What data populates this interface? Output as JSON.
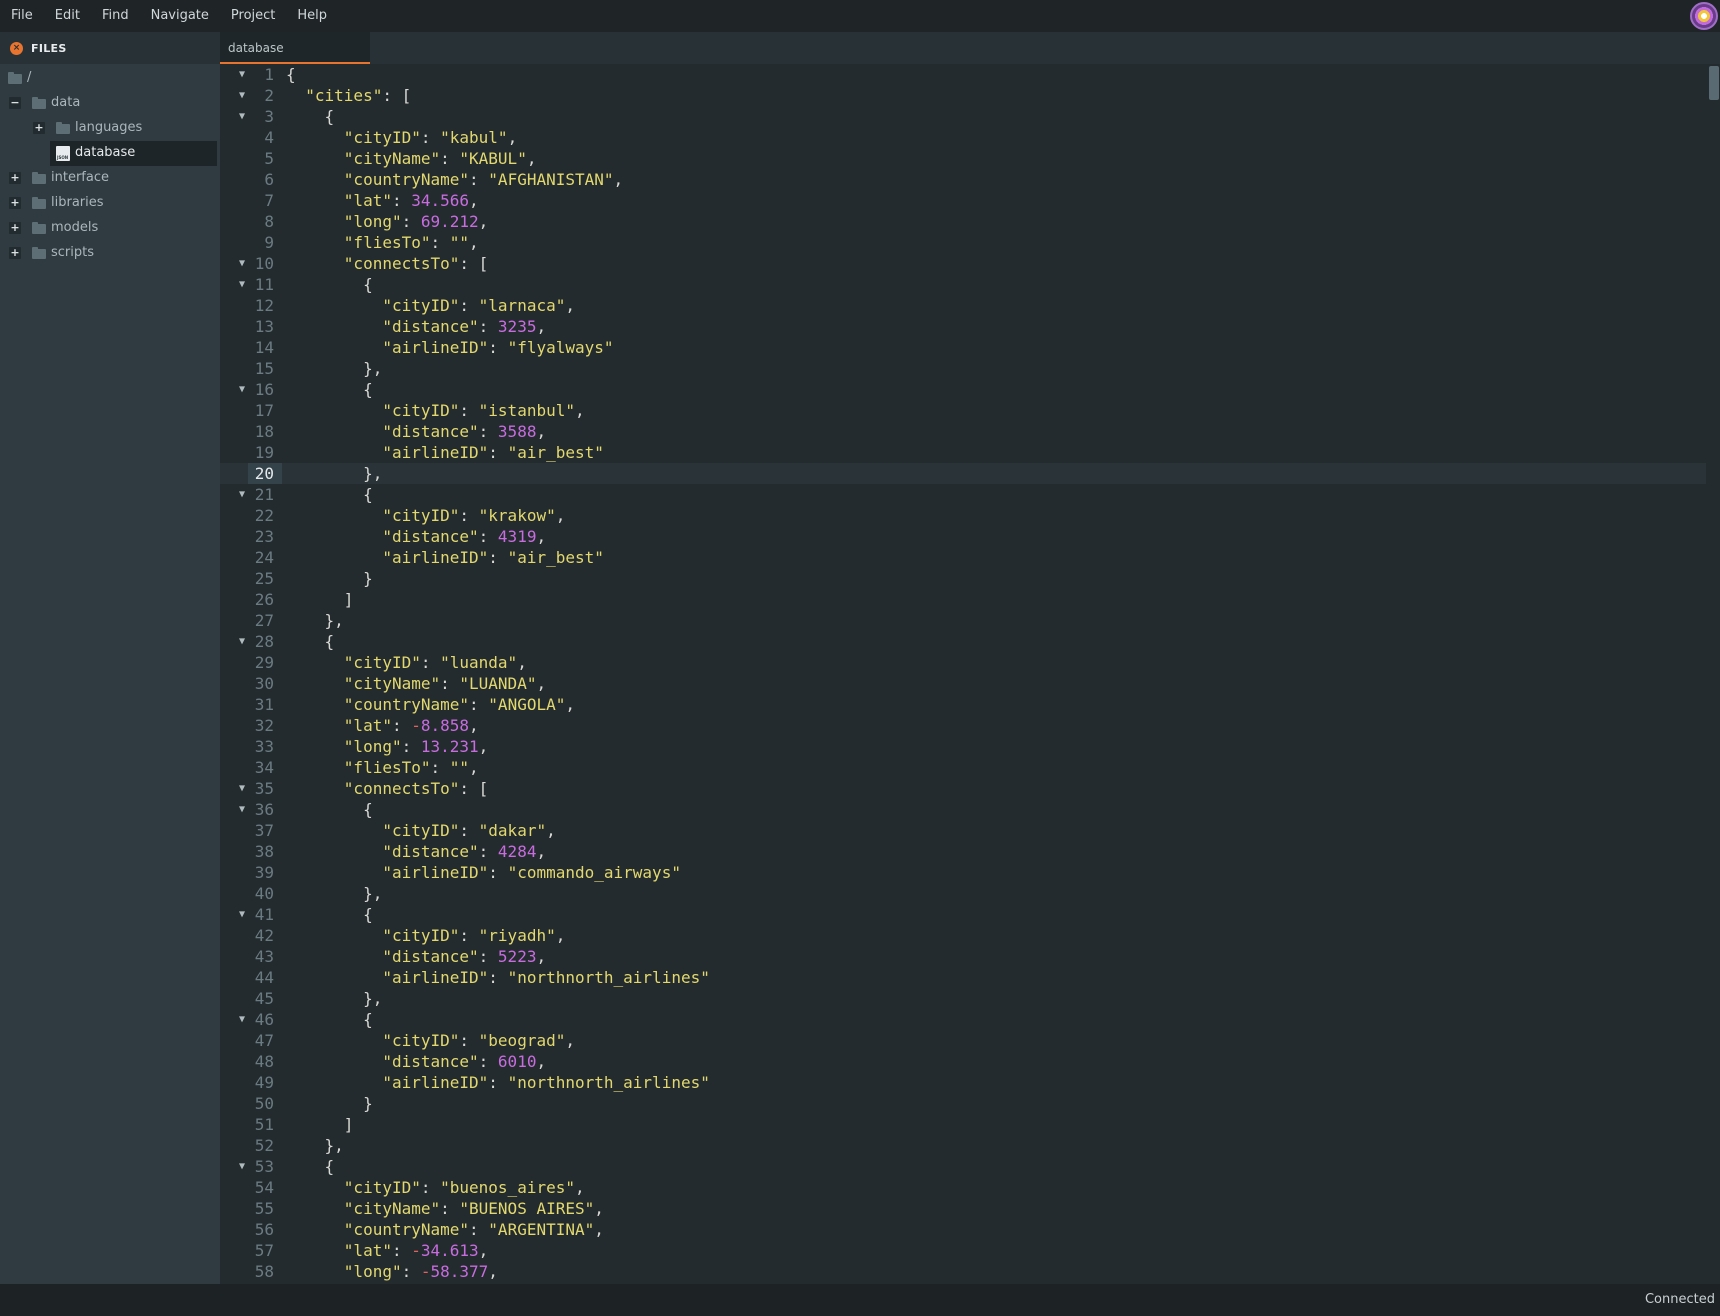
{
  "menubar": {
    "items": [
      "File",
      "Edit",
      "Find",
      "Navigate",
      "Project",
      "Help"
    ]
  },
  "sidebar": {
    "title": "FILES",
    "tree": [
      {
        "label": "/",
        "toggle": "",
        "type": "folder",
        "depth": 0
      },
      {
        "label": "data",
        "toggle": "−",
        "type": "folder",
        "depth": 1
      },
      {
        "label": "languages",
        "toggle": "+",
        "type": "folder",
        "depth": 2
      },
      {
        "label": "database",
        "toggle": "",
        "type": "file",
        "depth": 2,
        "selected": true
      },
      {
        "label": "interface",
        "toggle": "+",
        "type": "folder",
        "depth": 1
      },
      {
        "label": "libraries",
        "toggle": "+",
        "type": "folder",
        "depth": 1
      },
      {
        "label": "models",
        "toggle": "+",
        "type": "folder",
        "depth": 1
      },
      {
        "label": "scripts",
        "toggle": "+",
        "type": "folder",
        "depth": 1
      }
    ]
  },
  "tabs": [
    {
      "label": "database",
      "active": true
    }
  ],
  "editor": {
    "active_line": 20,
    "lines": [
      {
        "n": 1,
        "fold": true,
        "code": [
          [
            "p",
            "{"
          ]
        ]
      },
      {
        "n": 2,
        "fold": true,
        "code": [
          [
            "p",
            "  "
          ],
          [
            "k",
            "\"cities\""
          ],
          [
            "p",
            ": ["
          ]
        ]
      },
      {
        "n": 3,
        "fold": true,
        "code": [
          [
            "p",
            "    {"
          ]
        ]
      },
      {
        "n": 4,
        "fold": false,
        "code": [
          [
            "p",
            "      "
          ],
          [
            "k",
            "\"cityID\""
          ],
          [
            "p",
            ": "
          ],
          [
            "s",
            "\"kabul\""
          ],
          [
            "p",
            ","
          ]
        ]
      },
      {
        "n": 5,
        "fold": false,
        "code": [
          [
            "p",
            "      "
          ],
          [
            "k",
            "\"cityName\""
          ],
          [
            "p",
            ": "
          ],
          [
            "s",
            "\"KABUL\""
          ],
          [
            "p",
            ","
          ]
        ]
      },
      {
        "n": 6,
        "fold": false,
        "code": [
          [
            "p",
            "      "
          ],
          [
            "k",
            "\"countryName\""
          ],
          [
            "p",
            ": "
          ],
          [
            "s",
            "\"AFGHANISTAN\""
          ],
          [
            "p",
            ","
          ]
        ]
      },
      {
        "n": 7,
        "fold": false,
        "code": [
          [
            "p",
            "      "
          ],
          [
            "k",
            "\"lat\""
          ],
          [
            "p",
            ": "
          ],
          [
            "n",
            "34.566"
          ],
          [
            "p",
            ","
          ]
        ]
      },
      {
        "n": 8,
        "fold": false,
        "code": [
          [
            "p",
            "      "
          ],
          [
            "k",
            "\"long\""
          ],
          [
            "p",
            ": "
          ],
          [
            "n",
            "69.212"
          ],
          [
            "p",
            ","
          ]
        ]
      },
      {
        "n": 9,
        "fold": false,
        "code": [
          [
            "p",
            "      "
          ],
          [
            "k",
            "\"fliesTo\""
          ],
          [
            "p",
            ": "
          ],
          [
            "s",
            "\"\""
          ],
          [
            "p",
            ","
          ]
        ]
      },
      {
        "n": 10,
        "fold": true,
        "code": [
          [
            "p",
            "      "
          ],
          [
            "k",
            "\"connectsTo\""
          ],
          [
            "p",
            ": ["
          ]
        ]
      },
      {
        "n": 11,
        "fold": true,
        "code": [
          [
            "p",
            "        {"
          ]
        ]
      },
      {
        "n": 12,
        "fold": false,
        "code": [
          [
            "p",
            "          "
          ],
          [
            "k",
            "\"cityID\""
          ],
          [
            "p",
            ": "
          ],
          [
            "s",
            "\"larnaca\""
          ],
          [
            "p",
            ","
          ]
        ]
      },
      {
        "n": 13,
        "fold": false,
        "code": [
          [
            "p",
            "          "
          ],
          [
            "k",
            "\"distance\""
          ],
          [
            "p",
            ": "
          ],
          [
            "n",
            "3235"
          ],
          [
            "p",
            ","
          ]
        ]
      },
      {
        "n": 14,
        "fold": false,
        "code": [
          [
            "p",
            "          "
          ],
          [
            "k",
            "\"airlineID\""
          ],
          [
            "p",
            ": "
          ],
          [
            "s",
            "\"flyalways\""
          ]
        ]
      },
      {
        "n": 15,
        "fold": false,
        "code": [
          [
            "p",
            "        },"
          ]
        ]
      },
      {
        "n": 16,
        "fold": true,
        "code": [
          [
            "p",
            "        {"
          ]
        ]
      },
      {
        "n": 17,
        "fold": false,
        "code": [
          [
            "p",
            "          "
          ],
          [
            "k",
            "\"cityID\""
          ],
          [
            "p",
            ": "
          ],
          [
            "s",
            "\"istanbul\""
          ],
          [
            "p",
            ","
          ]
        ]
      },
      {
        "n": 18,
        "fold": false,
        "code": [
          [
            "p",
            "          "
          ],
          [
            "k",
            "\"distance\""
          ],
          [
            "p",
            ": "
          ],
          [
            "n",
            "3588"
          ],
          [
            "p",
            ","
          ]
        ]
      },
      {
        "n": 19,
        "fold": false,
        "code": [
          [
            "p",
            "          "
          ],
          [
            "k",
            "\"airlineID\""
          ],
          [
            "p",
            ": "
          ],
          [
            "s",
            "\"air_best\""
          ]
        ]
      },
      {
        "n": 20,
        "fold": false,
        "code": [
          [
            "p",
            "        },"
          ]
        ]
      },
      {
        "n": 21,
        "fold": true,
        "code": [
          [
            "p",
            "        {"
          ]
        ]
      },
      {
        "n": 22,
        "fold": false,
        "code": [
          [
            "p",
            "          "
          ],
          [
            "k",
            "\"cityID\""
          ],
          [
            "p",
            ": "
          ],
          [
            "s",
            "\"krakow\""
          ],
          [
            "p",
            ","
          ]
        ]
      },
      {
        "n": 23,
        "fold": false,
        "code": [
          [
            "p",
            "          "
          ],
          [
            "k",
            "\"distance\""
          ],
          [
            "p",
            ": "
          ],
          [
            "n",
            "4319"
          ],
          [
            "p",
            ","
          ]
        ]
      },
      {
        "n": 24,
        "fold": false,
        "code": [
          [
            "p",
            "          "
          ],
          [
            "k",
            "\"airlineID\""
          ],
          [
            "p",
            ": "
          ],
          [
            "s",
            "\"air_best\""
          ]
        ]
      },
      {
        "n": 25,
        "fold": false,
        "code": [
          [
            "p",
            "        }"
          ]
        ]
      },
      {
        "n": 26,
        "fold": false,
        "code": [
          [
            "p",
            "      ]"
          ]
        ]
      },
      {
        "n": 27,
        "fold": false,
        "code": [
          [
            "p",
            "    },"
          ]
        ]
      },
      {
        "n": 28,
        "fold": true,
        "code": [
          [
            "p",
            "    {"
          ]
        ]
      },
      {
        "n": 29,
        "fold": false,
        "code": [
          [
            "p",
            "      "
          ],
          [
            "k",
            "\"cityID\""
          ],
          [
            "p",
            ": "
          ],
          [
            "s",
            "\"luanda\""
          ],
          [
            "p",
            ","
          ]
        ]
      },
      {
        "n": 30,
        "fold": false,
        "code": [
          [
            "p",
            "      "
          ],
          [
            "k",
            "\"cityName\""
          ],
          [
            "p",
            ": "
          ],
          [
            "s",
            "\"LUANDA\""
          ],
          [
            "p",
            ","
          ]
        ]
      },
      {
        "n": 31,
        "fold": false,
        "code": [
          [
            "p",
            "      "
          ],
          [
            "k",
            "\"countryName\""
          ],
          [
            "p",
            ": "
          ],
          [
            "s",
            "\"ANGOLA\""
          ],
          [
            "p",
            ","
          ]
        ]
      },
      {
        "n": 32,
        "fold": false,
        "code": [
          [
            "p",
            "      "
          ],
          [
            "k",
            "\"lat\""
          ],
          [
            "p",
            ": "
          ],
          [
            "m",
            "-"
          ],
          [
            "n",
            "8.858"
          ],
          [
            "p",
            ","
          ]
        ]
      },
      {
        "n": 33,
        "fold": false,
        "code": [
          [
            "p",
            "      "
          ],
          [
            "k",
            "\"long\""
          ],
          [
            "p",
            ": "
          ],
          [
            "n",
            "13.231"
          ],
          [
            "p",
            ","
          ]
        ]
      },
      {
        "n": 34,
        "fold": false,
        "code": [
          [
            "p",
            "      "
          ],
          [
            "k",
            "\"fliesTo\""
          ],
          [
            "p",
            ": "
          ],
          [
            "s",
            "\"\""
          ],
          [
            "p",
            ","
          ]
        ]
      },
      {
        "n": 35,
        "fold": true,
        "code": [
          [
            "p",
            "      "
          ],
          [
            "k",
            "\"connectsTo\""
          ],
          [
            "p",
            ": ["
          ]
        ]
      },
      {
        "n": 36,
        "fold": true,
        "code": [
          [
            "p",
            "        {"
          ]
        ]
      },
      {
        "n": 37,
        "fold": false,
        "code": [
          [
            "p",
            "          "
          ],
          [
            "k",
            "\"cityID\""
          ],
          [
            "p",
            ": "
          ],
          [
            "s",
            "\"dakar\""
          ],
          [
            "p",
            ","
          ]
        ]
      },
      {
        "n": 38,
        "fold": false,
        "code": [
          [
            "p",
            "          "
          ],
          [
            "k",
            "\"distance\""
          ],
          [
            "p",
            ": "
          ],
          [
            "n",
            "4284"
          ],
          [
            "p",
            ","
          ]
        ]
      },
      {
        "n": 39,
        "fold": false,
        "code": [
          [
            "p",
            "          "
          ],
          [
            "k",
            "\"airlineID\""
          ],
          [
            "p",
            ": "
          ],
          [
            "s",
            "\"commando_airways\""
          ]
        ]
      },
      {
        "n": 40,
        "fold": false,
        "code": [
          [
            "p",
            "        },"
          ]
        ]
      },
      {
        "n": 41,
        "fold": true,
        "code": [
          [
            "p",
            "        {"
          ]
        ]
      },
      {
        "n": 42,
        "fold": false,
        "code": [
          [
            "p",
            "          "
          ],
          [
            "k",
            "\"cityID\""
          ],
          [
            "p",
            ": "
          ],
          [
            "s",
            "\"riyadh\""
          ],
          [
            "p",
            ","
          ]
        ]
      },
      {
        "n": 43,
        "fold": false,
        "code": [
          [
            "p",
            "          "
          ],
          [
            "k",
            "\"distance\""
          ],
          [
            "p",
            ": "
          ],
          [
            "n",
            "5223"
          ],
          [
            "p",
            ","
          ]
        ]
      },
      {
        "n": 44,
        "fold": false,
        "code": [
          [
            "p",
            "          "
          ],
          [
            "k",
            "\"airlineID\""
          ],
          [
            "p",
            ": "
          ],
          [
            "s",
            "\"northnorth_airlines\""
          ]
        ]
      },
      {
        "n": 45,
        "fold": false,
        "code": [
          [
            "p",
            "        },"
          ]
        ]
      },
      {
        "n": 46,
        "fold": true,
        "code": [
          [
            "p",
            "        {"
          ]
        ]
      },
      {
        "n": 47,
        "fold": false,
        "code": [
          [
            "p",
            "          "
          ],
          [
            "k",
            "\"cityID\""
          ],
          [
            "p",
            ": "
          ],
          [
            "s",
            "\"beograd\""
          ],
          [
            "p",
            ","
          ]
        ]
      },
      {
        "n": 48,
        "fold": false,
        "code": [
          [
            "p",
            "          "
          ],
          [
            "k",
            "\"distance\""
          ],
          [
            "p",
            ": "
          ],
          [
            "n",
            "6010"
          ],
          [
            "p",
            ","
          ]
        ]
      },
      {
        "n": 49,
        "fold": false,
        "code": [
          [
            "p",
            "          "
          ],
          [
            "k",
            "\"airlineID\""
          ],
          [
            "p",
            ": "
          ],
          [
            "s",
            "\"northnorth_airlines\""
          ]
        ]
      },
      {
        "n": 50,
        "fold": false,
        "code": [
          [
            "p",
            "        }"
          ]
        ]
      },
      {
        "n": 51,
        "fold": false,
        "code": [
          [
            "p",
            "      ]"
          ]
        ]
      },
      {
        "n": 52,
        "fold": false,
        "code": [
          [
            "p",
            "    },"
          ]
        ]
      },
      {
        "n": 53,
        "fold": true,
        "code": [
          [
            "p",
            "    {"
          ]
        ]
      },
      {
        "n": 54,
        "fold": false,
        "code": [
          [
            "p",
            "      "
          ],
          [
            "k",
            "\"cityID\""
          ],
          [
            "p",
            ": "
          ],
          [
            "s",
            "\"buenos_aires\""
          ],
          [
            "p",
            ","
          ]
        ]
      },
      {
        "n": 55,
        "fold": false,
        "code": [
          [
            "p",
            "      "
          ],
          [
            "k",
            "\"cityName\""
          ],
          [
            "p",
            ": "
          ],
          [
            "s",
            "\"BUENOS AIRES\""
          ],
          [
            "p",
            ","
          ]
        ]
      },
      {
        "n": 56,
        "fold": false,
        "code": [
          [
            "p",
            "      "
          ],
          [
            "k",
            "\"countryName\""
          ],
          [
            "p",
            ": "
          ],
          [
            "s",
            "\"ARGENTINA\""
          ],
          [
            "p",
            ","
          ]
        ]
      },
      {
        "n": 57,
        "fold": false,
        "code": [
          [
            "p",
            "      "
          ],
          [
            "k",
            "\"lat\""
          ],
          [
            "p",
            ": "
          ],
          [
            "m",
            "-"
          ],
          [
            "n",
            "34.613"
          ],
          [
            "p",
            ","
          ]
        ]
      },
      {
        "n": 58,
        "fold": false,
        "code": [
          [
            "p",
            "      "
          ],
          [
            "k",
            "\"long\""
          ],
          [
            "p",
            ": "
          ],
          [
            "m",
            "-"
          ],
          [
            "n",
            "58.377"
          ],
          [
            "p",
            ","
          ]
        ]
      }
    ]
  },
  "statusbar": {
    "text": "Connected"
  },
  "icons": {
    "fold_marker": "▼",
    "files": "files-icon",
    "folder": "folder-icon",
    "file": "json-file-icon",
    "logo": "app-logo"
  },
  "colors": {
    "accent": "#e8742f",
    "string": "#e2d86f",
    "number": "#c86ce0",
    "minus": "#e0635f"
  }
}
